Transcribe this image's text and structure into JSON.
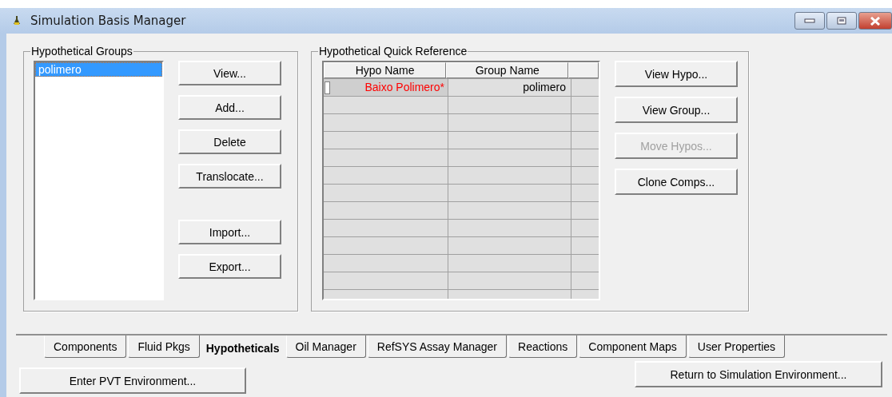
{
  "window": {
    "title": "Simulation Basis Manager"
  },
  "hypothetical_groups": {
    "title": "Hypothetical Groups",
    "items": [
      {
        "label": "polimero",
        "selected": true
      }
    ],
    "buttons": [
      {
        "label": "View...",
        "disabled": false
      },
      {
        "label": "Add...",
        "disabled": false
      },
      {
        "label": "Delete",
        "disabled": false
      },
      {
        "label": "Translocate...",
        "disabled": false
      },
      {
        "label": "Import...",
        "disabled": false
      },
      {
        "label": "Export...",
        "disabled": false
      }
    ]
  },
  "quick_reference": {
    "title": "Hypothetical Quick Reference",
    "columns": [
      "Hypo Name",
      "Group Name"
    ],
    "rows": [
      {
        "hypo_name": "Baixo Polimero*",
        "group_name": "polimero",
        "modified": true
      }
    ],
    "buttons": [
      {
        "label": "View Hypo...",
        "disabled": false
      },
      {
        "label": "View Group...",
        "disabled": false
      },
      {
        "label": "Move Hypos...",
        "disabled": true
      },
      {
        "label": "Clone Comps...",
        "disabled": false
      }
    ]
  },
  "tabs": [
    {
      "label": "Components",
      "selected": false
    },
    {
      "label": "Fluid Pkgs",
      "selected": false
    },
    {
      "label": "Hypotheticals",
      "selected": true
    },
    {
      "label": "Oil Manager",
      "selected": false
    },
    {
      "label": "RefSYS Assay Manager",
      "selected": false
    },
    {
      "label": "Reactions",
      "selected": false
    },
    {
      "label": "Component Maps",
      "selected": false
    },
    {
      "label": "User Properties",
      "selected": false
    }
  ],
  "footer_buttons": [
    "Enter PVT Environment...",
    "Return to Simulation Environment..."
  ]
}
